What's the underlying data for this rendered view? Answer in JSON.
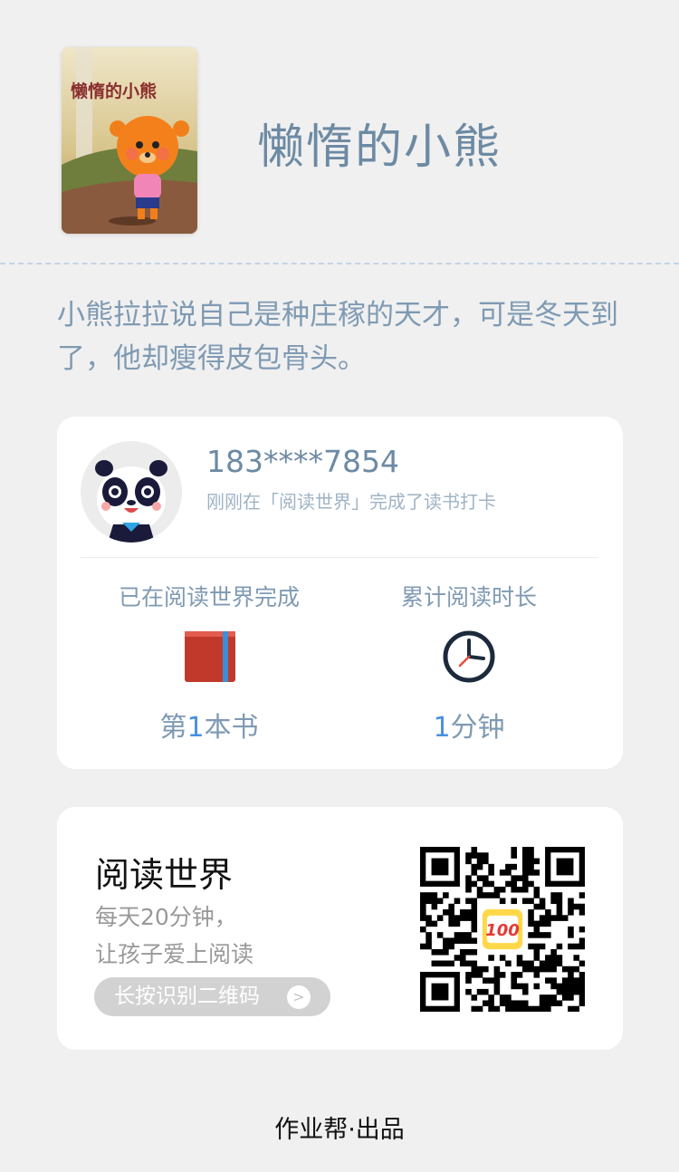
{
  "book": {
    "cover_title": "懒惰的小熊",
    "title": "懒惰的小熊",
    "summary": "小熊拉拉说自己是种庄稼的天才，可是冬天到了，他却瘦得皮包骨头。"
  },
  "user_card": {
    "phone": "183****7854",
    "checkin_text": "刚刚在「阅读世界」完成了读书打卡",
    "stats": [
      {
        "label": "已在阅读世界完成",
        "icon": "book-icon",
        "prefix": "第",
        "number": "1",
        "suffix": "本书"
      },
      {
        "label": "累计阅读时长",
        "icon": "clock-icon",
        "prefix": "",
        "number": "1",
        "suffix": "分钟"
      }
    ]
  },
  "promo": {
    "title": "阅读世界",
    "line1": "每天20分钟，",
    "line2": "让孩子爱上阅读",
    "qr_button": "长按识别二维码",
    "qr_logo_text": "100"
  },
  "footer": "作业帮·出品",
  "colors": {
    "accent": "#4a90e2",
    "title": "#6d8aa3",
    "muted": "#7f9ab3",
    "background": "#f0f0f0"
  }
}
